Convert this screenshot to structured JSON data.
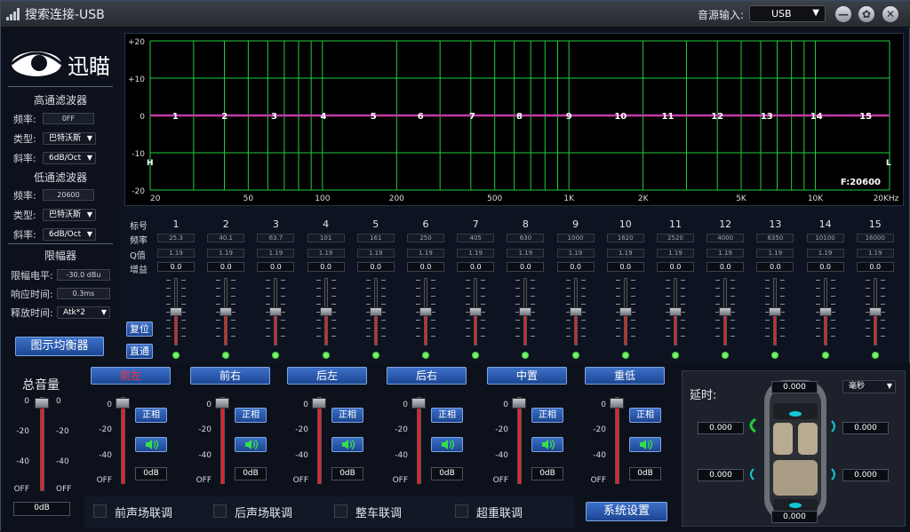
{
  "title_bar": {
    "title": "搜索连接-USB",
    "source_label": "音源输入:",
    "source_value": "USB"
  },
  "left_panel": {
    "logo_text": "迅瞄",
    "highpass": {
      "title": "高通滤波器",
      "freq_label": "频率:",
      "freq_value": "0FF",
      "type_label": "类型:",
      "type_value": "巴特沃斯",
      "slope_label": "斜率:",
      "slope_value": "6dB/Oct"
    },
    "lowpass": {
      "title": "低通滤波器",
      "freq_label": "频率:",
      "freq_value": "20600",
      "type_label": "类型:",
      "type_value": "巴特沃斯",
      "slope_label": "斜率:",
      "slope_value": "6dB/Oct"
    },
    "limiter": {
      "title": "限幅器",
      "level_label": "限幅电平:",
      "level_value": "-30.0 dBu",
      "response_label": "响应时间:",
      "response_value": "0.3ms",
      "release_label": "释放时间:",
      "release_value": "Atk*2"
    },
    "graphic_eq_button": "图示均衡器"
  },
  "graph": {
    "y_ticks": [
      "+20",
      "+10",
      "0",
      "-10",
      "-20"
    ],
    "x_ticks": [
      "20",
      "50",
      "100",
      "200",
      "500",
      "1K",
      "2K",
      "5K",
      "10K",
      "20KHz"
    ],
    "band_markers": [
      "1",
      "2",
      "3",
      "4",
      "5",
      "6",
      "7",
      "8",
      "9",
      "10",
      "11",
      "12",
      "13",
      "14",
      "15"
    ],
    "h_marker": "H",
    "l_marker": "L",
    "f_readout": "F:20600",
    "curve_color": "#c23aa8",
    "grid_color": "#1fcf3a"
  },
  "eq_table": {
    "row_labels": {
      "index": "标号",
      "freq": "频率",
      "q": "Q值",
      "gain": "增益"
    },
    "bands": [
      {
        "n": "1",
        "f": "25.3",
        "q": "1.19",
        "g": "0.0"
      },
      {
        "n": "2",
        "f": "40.1",
        "q": "1.19",
        "g": "0.0"
      },
      {
        "n": "3",
        "f": "63.7",
        "q": "1.19",
        "g": "0.0"
      },
      {
        "n": "4",
        "f": "101",
        "q": "1.19",
        "g": "0.0"
      },
      {
        "n": "5",
        "f": "161",
        "q": "1.19",
        "g": "0.0"
      },
      {
        "n": "6",
        "f": "250",
        "q": "1.19",
        "g": "0.0"
      },
      {
        "n": "7",
        "f": "405",
        "q": "1.19",
        "g": "0.0"
      },
      {
        "n": "8",
        "f": "630",
        "q": "1.19",
        "g": "0.0"
      },
      {
        "n": "9",
        "f": "1000",
        "q": "1.19",
        "g": "0.0"
      },
      {
        "n": "10",
        "f": "1620",
        "q": "1.19",
        "g": "0.0"
      },
      {
        "n": "11",
        "f": "2520",
        "q": "1.19",
        "g": "0.0"
      },
      {
        "n": "12",
        "f": "4000",
        "q": "1.19",
        "g": "0.0"
      },
      {
        "n": "13",
        "f": "6350",
        "q": "1.19",
        "g": "0.0"
      },
      {
        "n": "14",
        "f": "10100",
        "q": "1.19",
        "g": "0.0"
      },
      {
        "n": "15",
        "f": "16000",
        "q": "1.19",
        "g": "0.0"
      }
    ],
    "reset_button": "复位",
    "through_button": "直通"
  },
  "master": {
    "title": "总音量",
    "scale": [
      "0",
      "-20",
      "-40",
      "OFF"
    ],
    "value": "0dB"
  },
  "channels": [
    {
      "name": "前左",
      "phase": "正相",
      "value": "0dB",
      "active": true
    },
    {
      "name": "前右",
      "phase": "正相",
      "value": "0dB",
      "active": false
    },
    {
      "name": "后左",
      "phase": "正相",
      "value": "0dB",
      "active": false
    },
    {
      "name": "后右",
      "phase": "正相",
      "value": "0dB",
      "active": false
    },
    {
      "name": "中置",
      "phase": "正相",
      "value": "0dB",
      "active": false
    },
    {
      "name": "重低",
      "phase": "正相",
      "value": "0dB",
      "active": false
    }
  ],
  "channel_scale": [
    "0",
    "-20",
    "-40",
    "OFF"
  ],
  "link": {
    "front": "前声场联调",
    "rear": "后声场联调",
    "whole": "整车联调",
    "sub": "超重联调",
    "settings_button": "系统设置"
  },
  "delay": {
    "title": "延时:",
    "unit": "毫秒",
    "top": "0.000",
    "front_left": "0.000",
    "front_right": "0.000",
    "rear_left": "0.000",
    "rear_right": "0.000",
    "bottom": "0.000"
  }
}
